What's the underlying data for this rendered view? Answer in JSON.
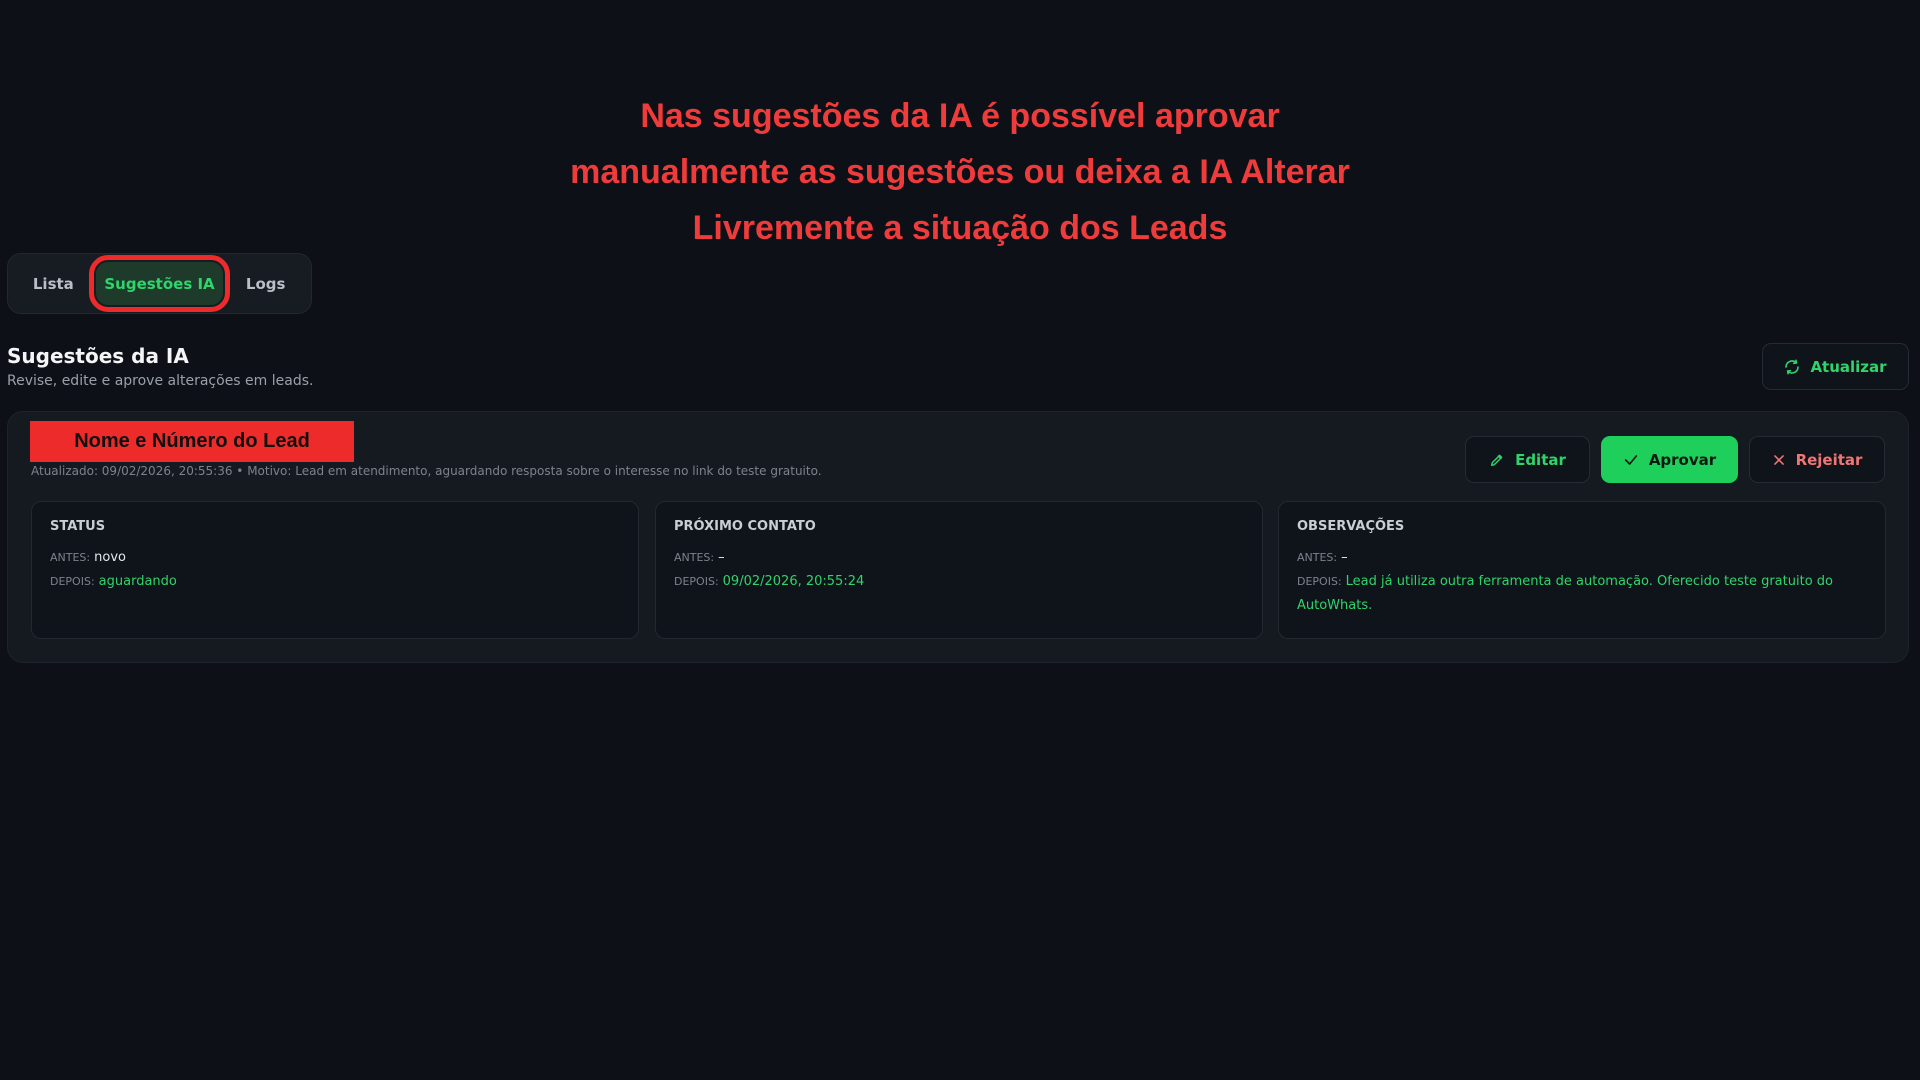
{
  "annotation": {
    "lines": [
      "Nas sugestões da IA é possível aprovar",
      "manualmente as sugestões ou deixa a IA Alterar",
      "Livremente a situação dos Leads"
    ]
  },
  "tabs": [
    {
      "label": "Lista",
      "active": false
    },
    {
      "label": "Sugestões IA",
      "active": true
    },
    {
      "label": "Logs",
      "active": false
    }
  ],
  "section": {
    "title": "Sugestões da IA",
    "subtitle": "Revise, edite e aprove alterações em leads."
  },
  "refresh_label": "Atualizar",
  "card": {
    "lead_label": "Nome e Número do Lead",
    "meta": "Atualizado: 09/02/2026, 20:55:36 • Motivo: Lead em atendimento, aguardando resposta sobre o interesse no link do teste gratuito.",
    "actions": {
      "edit": "Editar",
      "approve": "Aprovar",
      "reject": "Rejeitar"
    },
    "fields": [
      {
        "title": "STATUS",
        "before_label": "ANTES:",
        "before": "novo",
        "after_label": "DEPOIS:",
        "after": "aguardando"
      },
      {
        "title": "PRÓXIMO CONTATO",
        "before_label": "ANTES:",
        "before": "–",
        "after_label": "DEPOIS:",
        "after": "09/02/2026, 20:55:24"
      },
      {
        "title": "OBSERVAÇÕES",
        "before_label": "ANTES:",
        "before": "–",
        "after_label": "DEPOIS:",
        "after": "Lead já utiliza outra ferramenta de automação. Oferecido teste gratuito do AutoWhats."
      }
    ]
  },
  "colors": {
    "background": "#0d1016",
    "accent_green": "#2fd46b",
    "approve_green": "#1fcf5c",
    "reject_red": "#f07575",
    "annotation_red": "#ee3b3b"
  },
  "icons": {
    "refresh": "refresh-icon",
    "edit": "pencil-icon",
    "approve": "check-icon",
    "reject": "close-icon"
  }
}
